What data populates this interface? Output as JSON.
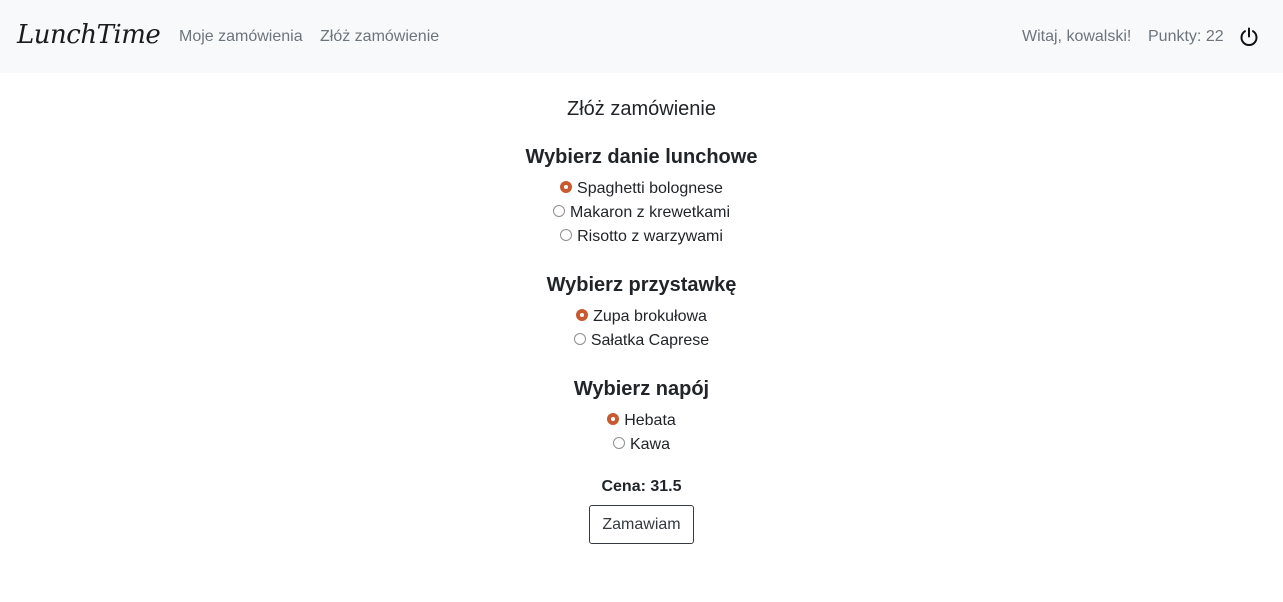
{
  "navbar": {
    "brand": "LunchTime",
    "links": {
      "my_orders": "Moje zamówienia",
      "place_order": "Złóż zamówienie"
    },
    "greeting": "Witaj, kowalski!",
    "points_label": "Punkty:",
    "points_value": "22",
    "logout_icon": "power-icon"
  },
  "page": {
    "title": "Złóż zamówienie"
  },
  "sections": {
    "lunch": {
      "heading": "Wybierz danie lunchowe",
      "options": [
        {
          "label": "Spaghetti bolognese",
          "checked": true
        },
        {
          "label": "Makaron z krewetkami",
          "checked": false
        },
        {
          "label": "Risotto z warzywami",
          "checked": false
        }
      ]
    },
    "starter": {
      "heading": "Wybierz przystawkę",
      "options": [
        {
          "label": "Zupa brokułowa",
          "checked": true
        },
        {
          "label": "Sałatka Caprese",
          "checked": false
        }
      ]
    },
    "drink": {
      "heading": "Wybierz napój",
      "options": [
        {
          "label": "Hebata",
          "checked": true
        },
        {
          "label": "Kawa",
          "checked": false
        }
      ]
    }
  },
  "price": {
    "label": "Cena:",
    "value": "31.5"
  },
  "submit": {
    "label": "Zamawiam"
  },
  "colors": {
    "navbar_bg": "#f8f9fa",
    "radio_accent": "#c85a31",
    "nav_link": "#6c757d"
  }
}
